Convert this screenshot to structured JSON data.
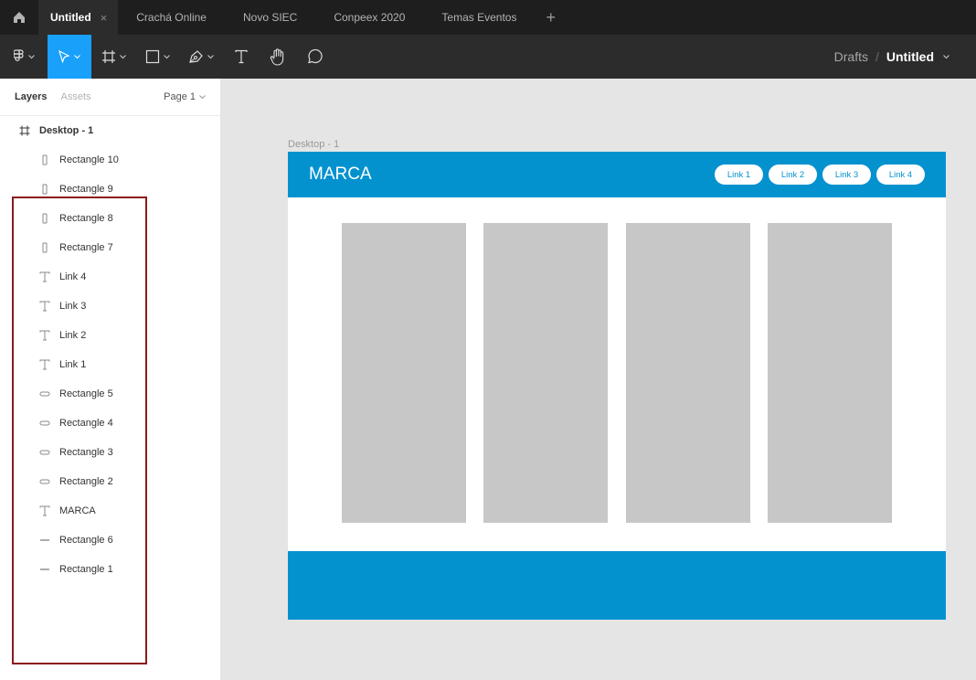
{
  "tabs": {
    "active": {
      "label": "Untitled",
      "close": "×"
    },
    "others": [
      "Crachá Online",
      "Novo SIEC",
      "Conpeex 2020",
      "Temas Eventos"
    ],
    "add": "+"
  },
  "toolbar": {
    "icons": [
      "figma-menu-icon",
      "move-tool-icon",
      "frame-tool-icon",
      "rectangle-tool-icon",
      "pen-tool-icon",
      "text-tool-icon",
      "hand-tool-icon",
      "comment-tool-icon"
    ],
    "breadcrumb": {
      "drafts": "Drafts",
      "separator": "/",
      "file": "Untitled"
    },
    "accent": "#18a0fb"
  },
  "panel": {
    "tab_layers": "Layers",
    "tab_assets": "Assets",
    "page": "Page 1",
    "frame": "Desktop - 1",
    "layers": [
      {
        "name": "Rectangle 10",
        "icon": "vertical-rectangle-icon"
      },
      {
        "name": "Rectangle 9",
        "icon": "vertical-rectangle-icon"
      },
      {
        "name": "Rectangle 8",
        "icon": "vertical-rectangle-icon"
      },
      {
        "name": "Rectangle 7",
        "icon": "vertical-rectangle-icon"
      },
      {
        "name": "Link 4",
        "icon": "text-icon"
      },
      {
        "name": "Link 3",
        "icon": "text-icon"
      },
      {
        "name": "Link 2",
        "icon": "text-icon"
      },
      {
        "name": "Link 1",
        "icon": "text-icon"
      },
      {
        "name": "Rectangle 5",
        "icon": "rounded-rectangle-icon"
      },
      {
        "name": "Rectangle 4",
        "icon": "rounded-rectangle-icon"
      },
      {
        "name": "Rectangle 3",
        "icon": "rounded-rectangle-icon"
      },
      {
        "name": "Rectangle 2",
        "icon": "rounded-rectangle-icon"
      },
      {
        "name": "MARCA",
        "icon": "text-icon"
      },
      {
        "name": "Rectangle 6",
        "icon": "line-rectangle-icon"
      },
      {
        "name": "Rectangle 1",
        "icon": "line-rectangle-icon"
      }
    ]
  },
  "canvas": {
    "frame_label": "Desktop - 1",
    "brand": "MARCA",
    "links": [
      "Link 1",
      "Link 2",
      "Link 3",
      "Link 4"
    ],
    "header_color": "#0492cf",
    "card_color": "#c7c7c7"
  }
}
